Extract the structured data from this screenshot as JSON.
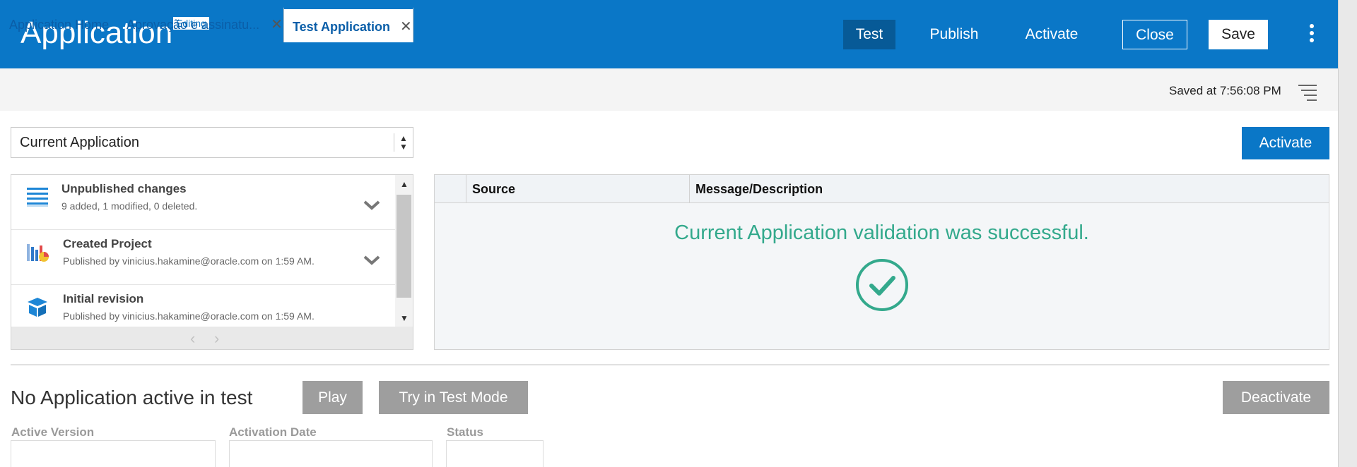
{
  "header": {
    "title": "Application",
    "badge": "Editing",
    "buttons": {
      "test": "Test",
      "publish": "Publish",
      "activate": "Activate",
      "close": "Close",
      "save": "Save"
    },
    "color": "#0a77c7"
  },
  "tabs": {
    "home": "Application Home",
    "approval": "Aprovação e assinatu...",
    "active": "Test Application",
    "close_glyph": "✕"
  },
  "saved_status": "Saved at 7:56:08 PM",
  "selector": {
    "value": "Current Application"
  },
  "activate_button": "Activate",
  "revisions": [
    {
      "title": "Unpublished changes",
      "subtitle": "9 added, 1 modified, 0 deleted.",
      "icon": "list-icon"
    },
    {
      "title": "Created Project",
      "subtitle": "Published by vinicius.hakamine@oracle.com on 1:59 AM.",
      "icon": "chart-project-icon"
    },
    {
      "title": "Initial revision",
      "subtitle": "Published by vinicius.hakamine@oracle.com on 1:59 AM.",
      "icon": "box-icon"
    }
  ],
  "validation": {
    "columns": [
      "",
      "Source",
      "Message/Description"
    ],
    "message": "Current Application validation was successful.",
    "success_color": "#33a98c"
  },
  "test_status": {
    "heading": "No Application active in test",
    "play": "Play",
    "try_test_mode": "Try in Test Mode",
    "deactivate": "Deactivate"
  },
  "fields": {
    "active_version": "Active Version",
    "activation_date": "Activation Date",
    "status": "Status"
  }
}
